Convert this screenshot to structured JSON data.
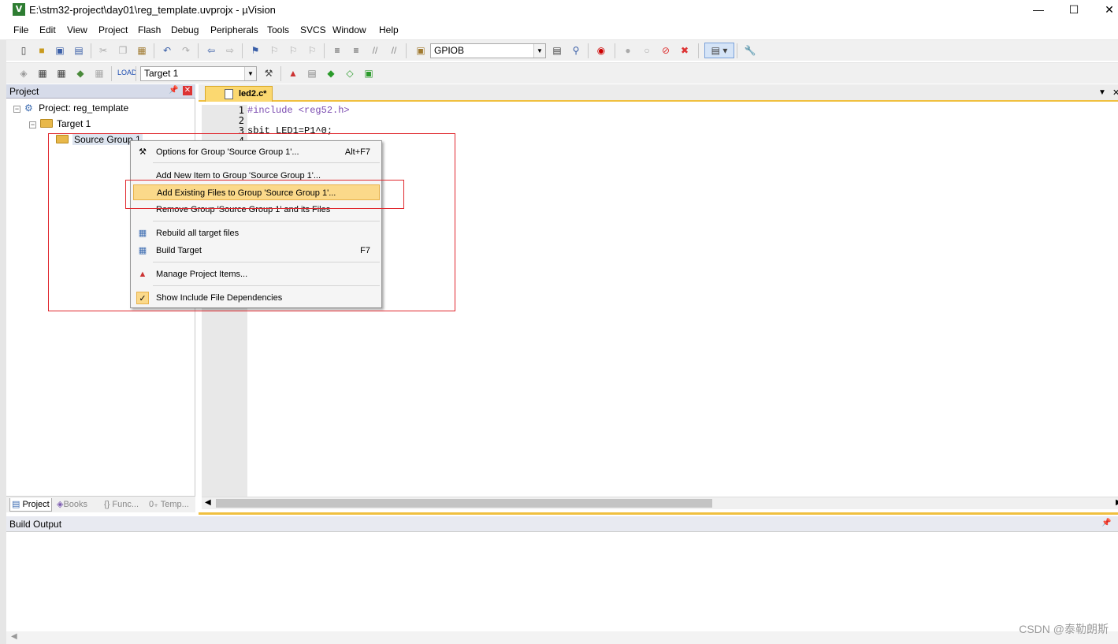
{
  "window": {
    "title": "E:\\stm32-project\\day01\\reg_template.uvprojx - µVision",
    "app_icon": "V",
    "minimize": "—",
    "maximize": "☐",
    "close": "✕"
  },
  "menu": [
    "File",
    "Edit",
    "View",
    "Project",
    "Flash",
    "Debug",
    "Peripherals",
    "Tools",
    "SVCS",
    "Window",
    "Help"
  ],
  "toolbar1": {
    "find_combo": "GPIOB"
  },
  "toolbar2": {
    "target_combo": "Target 1"
  },
  "project_panel": {
    "title": "Project",
    "tree": {
      "project": "Project: reg_template",
      "target": "Target 1",
      "group": "Source Group 1"
    },
    "tabs": [
      "Project",
      "Books",
      "{} Func...",
      "0₊ Temp..."
    ]
  },
  "editor": {
    "tab_label": "led2.c*",
    "lines": [
      {
        "n": "1",
        "text": "#include <reg52.h>"
      },
      {
        "n": "2",
        "text": ""
      },
      {
        "n": "3",
        "text": "sbit LED1=P1^0;"
      },
      {
        "n": "4",
        "text": ""
      }
    ]
  },
  "context_menu": {
    "items": [
      {
        "label": "Options for Group 'Source Group 1'...",
        "shortcut": "Alt+F7",
        "icon": "magic-wand-icon"
      },
      {
        "label": "Add New  Item to Group 'Source Group 1'...",
        "shortcut": ""
      },
      {
        "label": "Add Existing Files to Group 'Source Group 1'...",
        "shortcut": "",
        "highlighted": true
      },
      {
        "label": "Remove Group 'Source Group 1' and its Files",
        "shortcut": ""
      },
      {
        "label": "Rebuild all target files",
        "shortcut": "",
        "icon": "rebuild-icon"
      },
      {
        "label": "Build Target",
        "shortcut": "F7",
        "icon": "build-icon"
      },
      {
        "label": "Manage Project Items...",
        "shortcut": "",
        "icon": "manage-items-icon"
      },
      {
        "label": "Show Include File Dependencies",
        "shortcut": "",
        "icon": "checkmark-icon"
      }
    ]
  },
  "build_output": {
    "title": "Build Output"
  },
  "watermark": "CSDN @泰勒朗斯",
  "colors": {
    "highlight": "#fbd98a",
    "tab_active": "#fbd870",
    "annotation_red": "#e0282e",
    "panel_header": "#d6dbe9"
  }
}
